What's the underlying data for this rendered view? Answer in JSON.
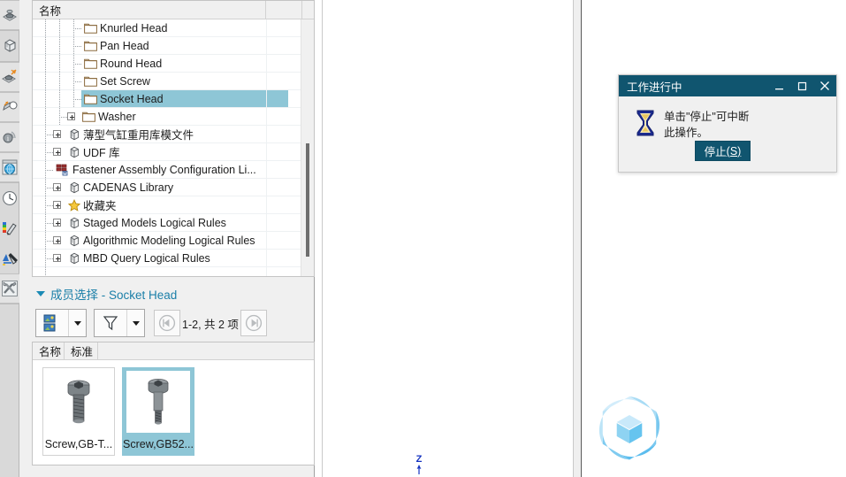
{
  "left_toolbar": {
    "groups": [
      {
        "buttons": [
          {
            "name": "sketch-plane-icon",
            "boxed": true
          }
        ]
      },
      {
        "buttons": [
          {
            "name": "part-model-icon",
            "boxed": false
          }
        ]
      },
      {
        "buttons": [
          {
            "name": "datum-plane-icon",
            "boxed": true
          },
          {
            "name": "datum-axis-point-icon",
            "boxed": true
          },
          {
            "name": "info-measure-icon",
            "boxed": true
          },
          {
            "name": "web-browser-icon",
            "boxed": true
          }
        ]
      },
      {
        "buttons": [
          {
            "name": "clock-history-icon",
            "boxed": false
          },
          {
            "name": "appearance-paint-icon",
            "boxed": false
          },
          {
            "name": "style-picker-icon",
            "boxed": false
          },
          {
            "name": "tools-utilities-icon",
            "boxed": true
          }
        ]
      }
    ]
  },
  "tree": {
    "columns": [
      {
        "label": "名称"
      },
      {
        "label": ""
      }
    ],
    "rows": [
      {
        "label": "Knurled Head",
        "icon": "folder-icon",
        "depth": 3,
        "expander": false,
        "selected": false
      },
      {
        "label": "Pan Head",
        "icon": "folder-icon",
        "depth": 3,
        "expander": false,
        "selected": false
      },
      {
        "label": "Round Head",
        "icon": "folder-icon",
        "depth": 3,
        "expander": false,
        "selected": false
      },
      {
        "label": "Set Screw",
        "icon": "folder-icon",
        "depth": 3,
        "expander": false,
        "selected": false
      },
      {
        "label": "Socket Head",
        "icon": "folder-icon",
        "depth": 3,
        "expander": false,
        "selected": true
      },
      {
        "label": "Washer",
        "icon": "folder-icon",
        "depth": 2,
        "expander": true,
        "selected": false
      },
      {
        "label": "薄型气缸重用库模文件",
        "icon": "library-icon",
        "depth": 1,
        "expander": true,
        "selected": false
      },
      {
        "label": "UDF 库",
        "icon": "library-icon",
        "depth": 1,
        "expander": true,
        "selected": false
      },
      {
        "label": "Fastener Assembly Configuration Li...",
        "icon": "config-list-icon",
        "depth": 1,
        "expander": false,
        "selected": false
      },
      {
        "label": "CADENAS Library",
        "icon": "library-icon",
        "depth": 1,
        "expander": true,
        "selected": false
      },
      {
        "label": "收藏夹",
        "icon": "star-icon",
        "depth": 1,
        "expander": true,
        "selected": false
      },
      {
        "label": "Staged Models Logical Rules",
        "icon": "library-icon",
        "depth": 1,
        "expander": true,
        "selected": false
      },
      {
        "label": "Algorithmic Modeling Logical Rules",
        "icon": "library-icon",
        "depth": 1,
        "expander": true,
        "selected": false
      },
      {
        "label": "MBD Query Logical Rules",
        "icon": "library-icon",
        "depth": 1,
        "expander": true,
        "selected": false
      },
      {
        "label": "",
        "icon": "none",
        "depth": 1,
        "expander": false,
        "selected": false
      }
    ],
    "scrollbar": {
      "name": "tree-vertical-scrollbar"
    }
  },
  "member_selection": {
    "title_prefix": "成员选择",
    "title_sep": "-",
    "title_target": "Socket Head",
    "title_full": "成员选择 - Socket Head",
    "toolbar": {
      "view_mode_icon": "thumbnail-view-icon",
      "view_mode_caret": "chevron-down-icon",
      "filter_icon": "filter-funnel-icon",
      "filter_caret": "chevron-down-icon",
      "prev_page_icon": "first-page-icon",
      "next_page_icon": "last-page-icon",
      "page_count": "1-2, 共 2 项"
    },
    "columns": [
      {
        "label": "名称"
      },
      {
        "label": "标准"
      },
      {
        "label": ""
      }
    ],
    "items": [
      {
        "label": "Screw,GB-T...",
        "icon": "socket-head-screw-thumb",
        "selected": false
      },
      {
        "label": "Screw,GB52...",
        "icon": "shoulder-screw-thumb",
        "selected": true
      }
    ]
  },
  "viewport": {
    "watermark_icon": "hex-cube-logo",
    "axis_label": "Z",
    "axis_icon": "z-axis-arrow-icon"
  },
  "dialog": {
    "title": "工作进行中",
    "minimize_icon": "minimize-icon",
    "maximize_icon": "maximize-icon",
    "close_icon": "close-icon",
    "status_icon": "hourglass-icon",
    "message_line1": "单击\"停止\"可中断",
    "message_line2": "此操作。",
    "stop_button_label": "停止",
    "stop_button_accel": "(S)"
  },
  "colors": {
    "selection": "#8ec6d6",
    "dialog_titlebar": "#10556f",
    "accent_link": "#1b7fa8",
    "folder_outline": "#8a6a3d",
    "panel_bg": "#f0f0f0",
    "toolbar_bg": "#d9d9d9",
    "axis_blue": "#1433c0",
    "logo_blue": "#7dc8ee"
  }
}
